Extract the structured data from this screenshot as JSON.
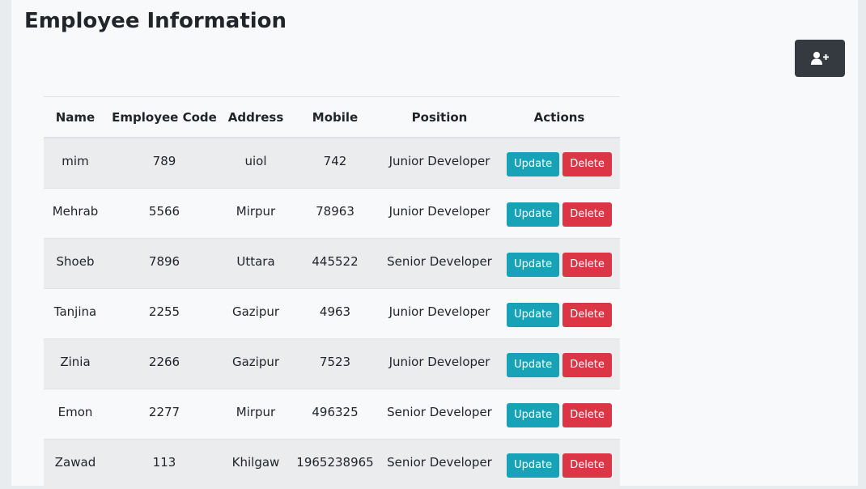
{
  "page": {
    "title": "Employee Information",
    "add_button_icon": "user-plus-icon"
  },
  "colors": {
    "update": "#17a2b8",
    "delete": "#dc3545",
    "add_button": "#343a40"
  },
  "table": {
    "headers": [
      "Name",
      "Employee Code",
      "Address",
      "Mobile",
      "Position",
      "Actions"
    ],
    "update_label": "Update",
    "delete_label": "Delete",
    "rows": [
      {
        "name": "mim",
        "code": "789",
        "address": "uiol",
        "mobile": "742",
        "position": "Junior Developer"
      },
      {
        "name": "Mehrab",
        "code": "5566",
        "address": "Mirpur",
        "mobile": "78963",
        "position": "Junior Developer"
      },
      {
        "name": "Shoeb",
        "code": "7896",
        "address": "Uttara",
        "mobile": "445522",
        "position": "Senior Developer"
      },
      {
        "name": "Tanjina",
        "code": "2255",
        "address": "Gazipur",
        "mobile": "4963",
        "position": "Junior Developer"
      },
      {
        "name": "Zinia",
        "code": "2266",
        "address": "Gazipur",
        "mobile": "7523",
        "position": "Junior Developer"
      },
      {
        "name": "Emon",
        "code": "2277",
        "address": "Mirpur",
        "mobile": "496325",
        "position": "Senior Developer"
      },
      {
        "name": "Zawad",
        "code": "113",
        "address": "Khilgaw",
        "mobile": "1965238965",
        "position": "Senior Developer"
      }
    ]
  }
}
